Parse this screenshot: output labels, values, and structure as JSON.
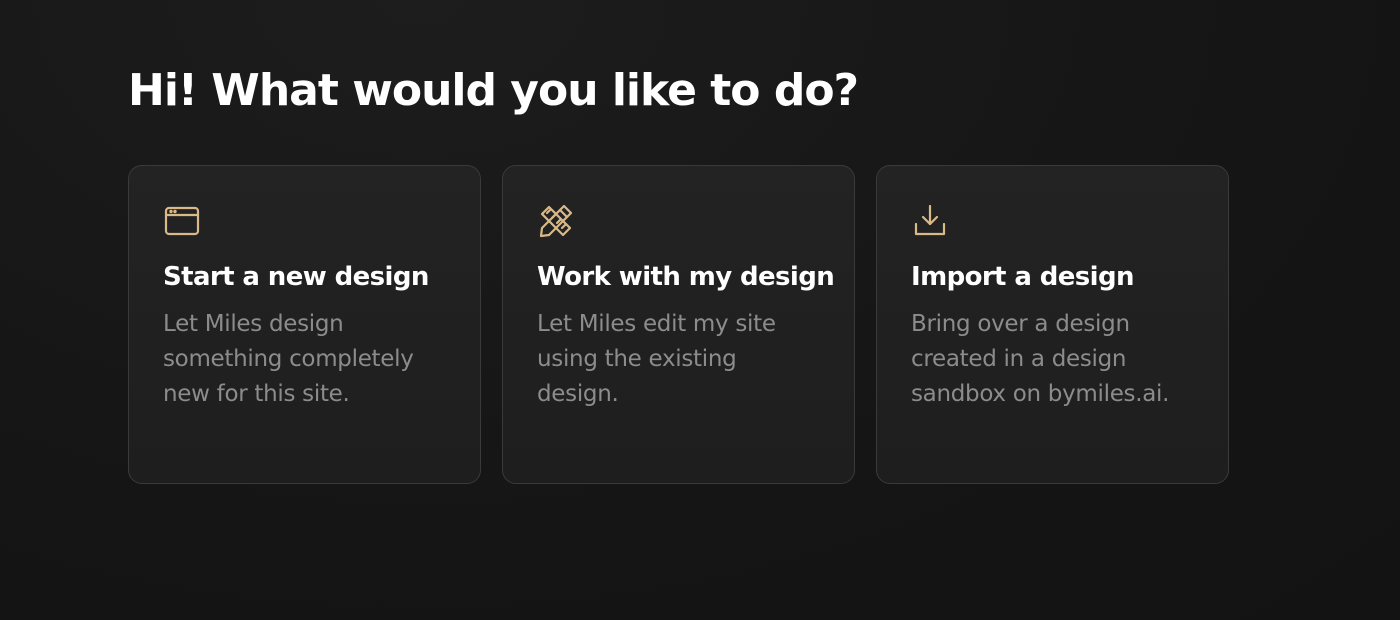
{
  "page": {
    "heading": "Hi! What would you like to do?"
  },
  "accent_color": "#d9b98a",
  "cards": [
    {
      "icon": "browser-window-icon",
      "title": "Start a new design",
      "description": "Let Miles design something completely new for this site."
    },
    {
      "icon": "pencil-ruler-icon",
      "title": "Work with my design",
      "description": "Let Miles edit my site using the existing design."
    },
    {
      "icon": "download-icon",
      "title": "Import a design",
      "description": "Bring over a design created in a design sandbox on bymiles.ai."
    }
  ]
}
